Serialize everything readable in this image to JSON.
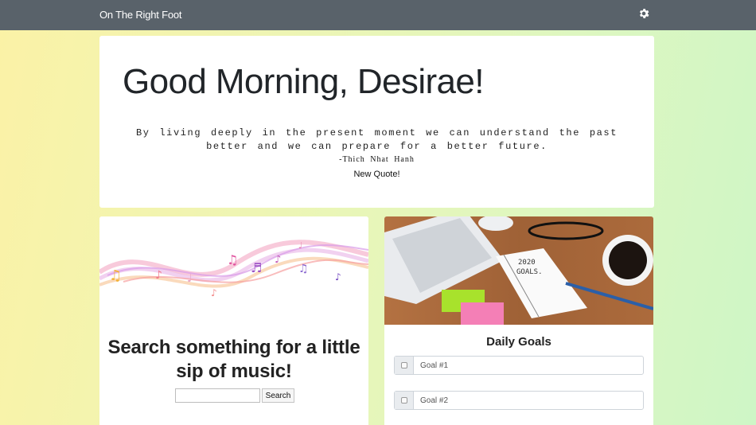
{
  "navbar": {
    "brand": "On The Right Foot",
    "settings_icon": "gear-icon"
  },
  "greeting_card": {
    "greeting": "Good Morning, Desirae!",
    "quote_text": "By living deeply in the present moment we can understand the past better and we can prepare for a better future.",
    "quote_author": "-Thich Nhat Hanh",
    "new_quote_label": "New Quote!"
  },
  "music_card": {
    "image": "music-notes-banner",
    "title": "Search something for a little sip of music!",
    "search_input_value": "",
    "search_button_label": "Search"
  },
  "goals_card": {
    "image": "desk-2020-goals-photo",
    "title": "Daily Goals",
    "goals": [
      {
        "placeholder": "Goal #1",
        "checked": false
      },
      {
        "placeholder": "Goal #2",
        "checked": false
      }
    ]
  },
  "colors": {
    "navbar": "#59626a",
    "card_background": "#ffffff",
    "background_gradient": [
      "#fbf2a6",
      "#cef6c6"
    ]
  }
}
